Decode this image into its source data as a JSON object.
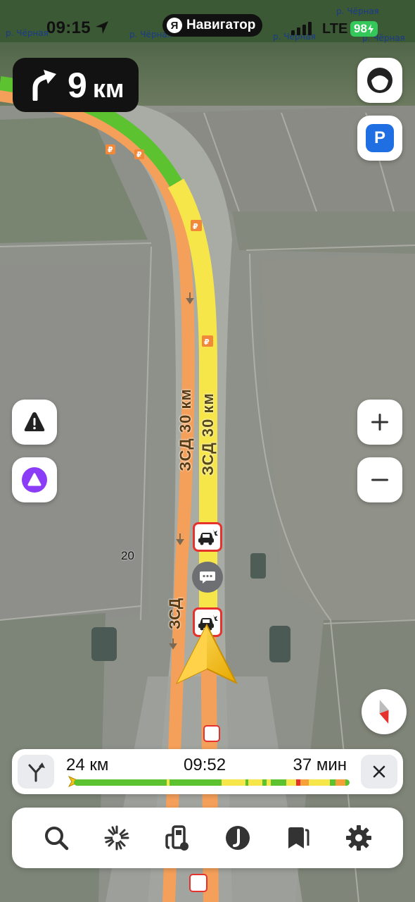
{
  "status_bar": {
    "time": "09:15",
    "app_letter": "Я",
    "app_name": "Навигатор",
    "network": "LTE",
    "battery": "98"
  },
  "map": {
    "place_labels": [
      "р. Чёрная",
      "р. Чёрная",
      "р. Чёрная",
      "р. Чёрная",
      "р. Чёрная"
    ],
    "road_labels": {
      "left_lane": "ЗСД 30 км",
      "right_lane": "ЗСД 30 км",
      "short": "ЗСД"
    },
    "marker_20": "20",
    "route_color": "#fbe722",
    "alt_road_color": "#f5a05a",
    "traffic_green": "#5cc22f",
    "traffic_yellow": "#f6e64a"
  },
  "maneuver": {
    "direction": "turn-right-icon",
    "distance": "9",
    "unit": "км"
  },
  "route_info": {
    "remaining_distance": "24 км",
    "arrival_time": "09:52",
    "remaining_time": "37 мин"
  },
  "colors": {
    "accent_blue": "#1f6fe3",
    "battery_green": "#34c759",
    "alice_purple": "#8b3cf7",
    "cursor_yellow": "#f7c318"
  }
}
